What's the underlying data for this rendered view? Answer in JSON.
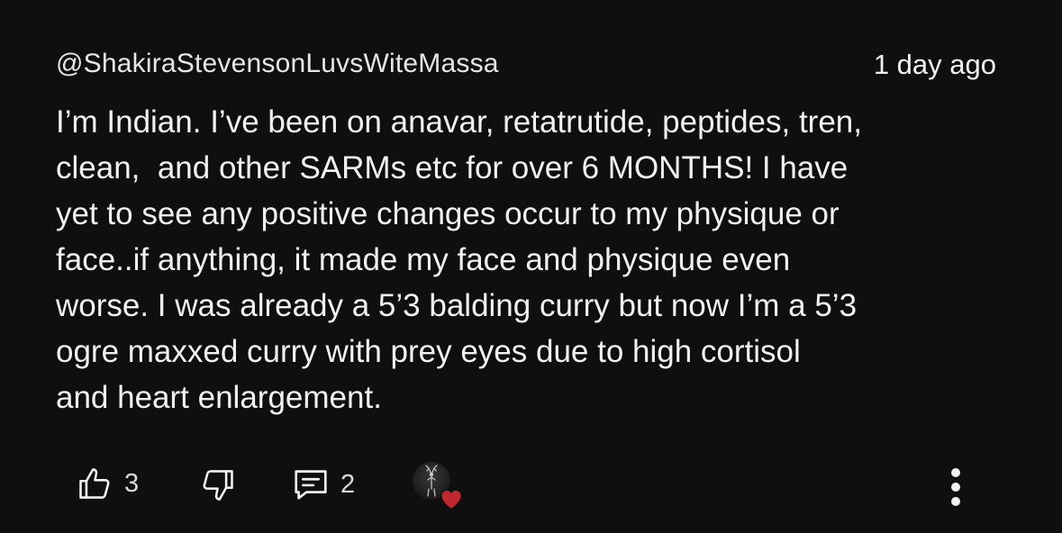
{
  "comment": {
    "author": "@ShakiraStevensonLuvsWiteMassa",
    "timestamp": "1 day ago",
    "text": "I’m Indian. I’ve been on anavar, retatrutide, peptides, tren,\nclean,  and other SARMs etc for over 6 MONTHS! I have\nyet to see any positive changes occur to my physique or\nface..if anything, it made my face and physique even\nworse. I was already a 5’3 balding curry but now I’m a 5’3\nogre maxxed curry with prey eyes due to high cortisol\nand heart enlargement."
  },
  "actions": {
    "like_count": "3",
    "reply_count": "2",
    "icons": {
      "like": "thumbs-up-icon",
      "dislike": "thumbs-down-icon",
      "reply": "comment-bubble-icon",
      "creator_heart": "heart-icon",
      "menu": "more-vertical-icon"
    }
  },
  "colors": {
    "background": "#0f0f0f",
    "text": "#f1f1f1",
    "heart": "#c0282d"
  }
}
